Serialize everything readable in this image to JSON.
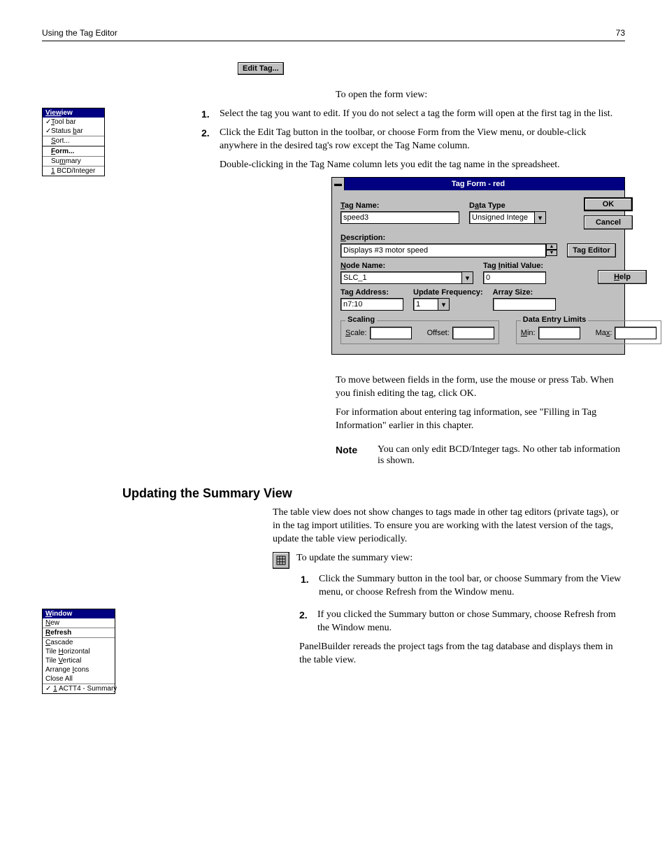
{
  "header": {
    "left": "Using the Tag Editor",
    "right": "73"
  },
  "toolbar_btn": {
    "label": "Edit Tag..."
  },
  "intro": {
    "p1": "To open the form view:",
    "s1": {
      "num": "1.",
      "text": "Select the tag you want to edit. If you do not select a tag the form will open at the first tag in the list."
    },
    "s2a": {
      "num": "2.",
      "text": "Click the Edit Tag button in the toolbar, or choose Form from the View menu, or double-click anywhere in the desired tag's row except the Tag Name column."
    },
    "s2b": "Double-clicking in the Tag Name column lets you edit the tag name in the spreadsheet."
  },
  "view_menu": {
    "title": "View",
    "items": [
      {
        "check": "✓",
        "label_pre": "",
        "u": "T",
        "label_post": "ool bar"
      },
      {
        "check": "✓",
        "label_pre": "Status ",
        "u": "b",
        "label_post": "ar"
      },
      {
        "check": "",
        "label_pre": "",
        "u": "S",
        "label_post": "ort..."
      },
      {
        "check": "",
        "label_pre": "",
        "u": "F",
        "label_post": "orm..."
      },
      {
        "check": "",
        "label_pre": "Su",
        "u": "m",
        "label_post": "mary"
      },
      {
        "check": "",
        "label_pre": "",
        "u": "1",
        "label_post": " BCD/Integer"
      }
    ]
  },
  "dialog": {
    "title": "Tag Form - red",
    "labels": {
      "tag_name": "Tag Name:",
      "tag_name_u": "T",
      "data_type": "Data Type",
      "data_type_u": "a",
      "description": "Description:",
      "description_u": "D",
      "node_name": "Node Name:",
      "node_name_u": "N",
      "initial": "Tag Initial Value:",
      "initial_u": "I",
      "tag_address": "Tag Address:",
      "update_freq": "Update Frequency:",
      "array_size": "Array Size:",
      "scaling": "Scaling",
      "scale": "Scale:",
      "scale_u": "S",
      "offset": "Offset:",
      "limits": "Data Entry Limits",
      "min": "Min:",
      "min_u": "M",
      "max": "Max:",
      "max_u": "x"
    },
    "vals": {
      "tag_name": "speed3",
      "data_type": "Unsigned Intege",
      "description": "Displays #3 motor speed",
      "node_name": "SLC_1",
      "initial": "0",
      "tag_address": "n7:10",
      "update_freq": "1",
      "array_size": "",
      "scale": "",
      "offset": "",
      "min": "",
      "max": ""
    },
    "buttons": {
      "ok": "OK",
      "cancel": "Cancel",
      "tag_editor": "Tag Editor",
      "help": "Help",
      "help_u": "H"
    }
  },
  "after_dialog": {
    "p1": "To move between fields in the form, use the mouse or press Tab. When you finish editing the tag, click OK.",
    "p2": "For information about entering tag information, see \"Filling in Tag Information\" earlier in this chapter.",
    "note_label": "Note",
    "note_body": "You can only edit BCD/Integer tags. No other tab information is shown."
  },
  "summary": {
    "heading": "Updating the Summary View",
    "p1": "The table view does not show changes to tags made in other tag editors (private tags), or in the tag import utilities. To ensure you are working with the latest version of the tags, update the table view periodically.",
    "p2": "To update the summary view:",
    "s1": {
      "num": "1.",
      "text": "Click the Summary button in the tool bar, or choose Summary from the View menu, or choose Refresh from the Window menu."
    }
  },
  "window_menu": {
    "title": "Window",
    "items": [
      {
        "label_pre": "",
        "u": "N",
        "label_post": "ew"
      },
      {
        "label_pre": "",
        "u": "R",
        "label_post": "efresh"
      },
      {
        "label_pre": "",
        "u": "C",
        "label_post": "ascade"
      },
      {
        "label_pre": "Tile ",
        "u": "H",
        "label_post": "orizontal"
      },
      {
        "label_pre": "Tile ",
        "u": "V",
        "label_post": "ertical"
      },
      {
        "label_pre": "Arrange ",
        "u": "I",
        "label_post": "cons"
      },
      {
        "label_pre": "Close All",
        "u": "",
        "label_post": ""
      },
      {
        "label_pre": "✓ ",
        "u": "1",
        "label_post": " ACTT4 - Summary"
      }
    ]
  },
  "step2": {
    "num": "2.",
    "text": "If you clicked the Summary button or chose Summary, choose Refresh from the Window menu."
  },
  "final": "PanelBuilder rereads the project tags from the tag database and displays them in the table view."
}
